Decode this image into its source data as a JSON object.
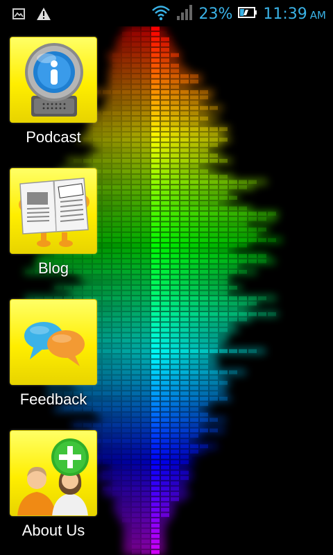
{
  "status_bar": {
    "battery_percent": "23%",
    "time": "11:39",
    "am_pm": "AM",
    "icons": [
      "image-icon",
      "warning-icon",
      "wifi-icon",
      "signal-icon",
      "battery-icon"
    ]
  },
  "menu": {
    "items": [
      {
        "label": "Podcast",
        "icon": "podcast-icon"
      },
      {
        "label": "Blog",
        "icon": "newspaper-icon"
      },
      {
        "label": "Feedback",
        "icon": "chat-bubbles-icon"
      },
      {
        "label": "About Us",
        "icon": "add-people-icon"
      }
    ]
  },
  "colors": {
    "tile_yellow": "#ffee00",
    "status_blue": "#3ab2e6",
    "background": "#000000"
  }
}
